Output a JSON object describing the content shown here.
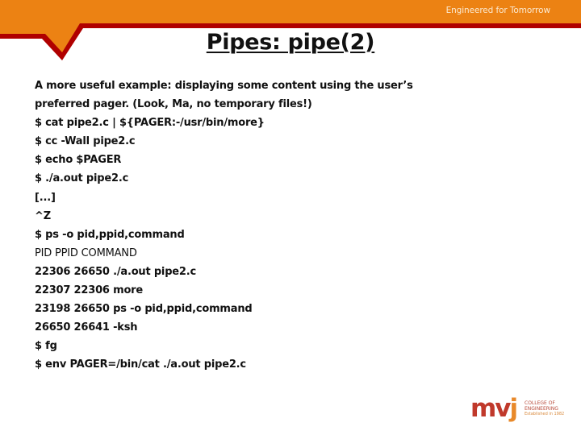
{
  "header": {
    "tagline": "Engineered for Tomorrow",
    "colors": {
      "banner_orange": "#ec8213",
      "banner_stripe_red": "#b00000"
    }
  },
  "slide": {
    "title": "Pipes: pipe(2)",
    "lines": [
      {
        "text": "A more useful example: displaying some content using the user’s",
        "style": "bold"
      },
      {
        "text": "preferred pager. (Look, Ma, no temporary files!)",
        "style": "bold"
      },
      {
        "text": "$ cat pipe2.c | ${PAGER:-/usr/bin/more}",
        "style": "bold"
      },
      {
        "text": "$ cc -Wall pipe2.c",
        "style": "bold"
      },
      {
        "text": "$ echo $PAGER",
        "style": "bold"
      },
      {
        "text": "$ ./a.out pipe2.c",
        "style": "bold"
      },
      {
        "text": "[...]",
        "style": "bold"
      },
      {
        "text": "^Z",
        "style": "bold"
      },
      {
        "text": "$ ps -o pid,ppid,command",
        "style": "bold"
      },
      {
        "text": "PID PPID COMMAND",
        "style": "normal"
      },
      {
        "text": "22306 26650 ./a.out pipe2.c",
        "style": "bold"
      },
      {
        "text": "22307 22306 more",
        "style": "bold"
      },
      {
        "text": "23198 26650 ps -o pid,ppid,command",
        "style": "bold"
      },
      {
        "text": "26650 26641 -ksh",
        "style": "bold"
      },
      {
        "text": "$ fg",
        "style": "bold"
      },
      {
        "text": "$ env PAGER=/bin/cat ./a.out pipe2.c",
        "style": "bold"
      }
    ]
  },
  "logo": {
    "mark_main": "mv",
    "mark_accent": "j",
    "line1": "COLLEGE OF",
    "line2": "ENGINEERING",
    "line3": "Established in 1982",
    "colors": {
      "mark_red": "#c0392b",
      "mark_orange": "#e8892a"
    }
  }
}
